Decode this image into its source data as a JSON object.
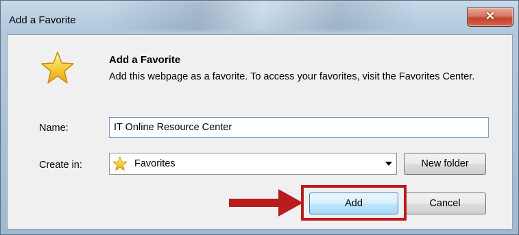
{
  "window": {
    "title": "Add a Favorite",
    "close_glyph": "✕"
  },
  "dialog": {
    "icon": "star-icon",
    "heading": "Add a Favorite",
    "description": "Add this webpage as a favorite. To access your favorites, visit the Favorites Center.",
    "name_label": "Name:",
    "name_value": "IT Online Resource Center",
    "create_in_label": "Create in:",
    "create_in_value": "Favorites",
    "new_folder_label": "New folder",
    "add_label": "Add",
    "cancel_label": "Cancel"
  },
  "annotation": {
    "highlight_color": "#b81c1c",
    "arrow_color": "#b81c1c"
  },
  "colors": {
    "close_button": "#c94a35",
    "add_button_border": "#3c7fb1",
    "dialog_background": "#f0f0f0"
  }
}
